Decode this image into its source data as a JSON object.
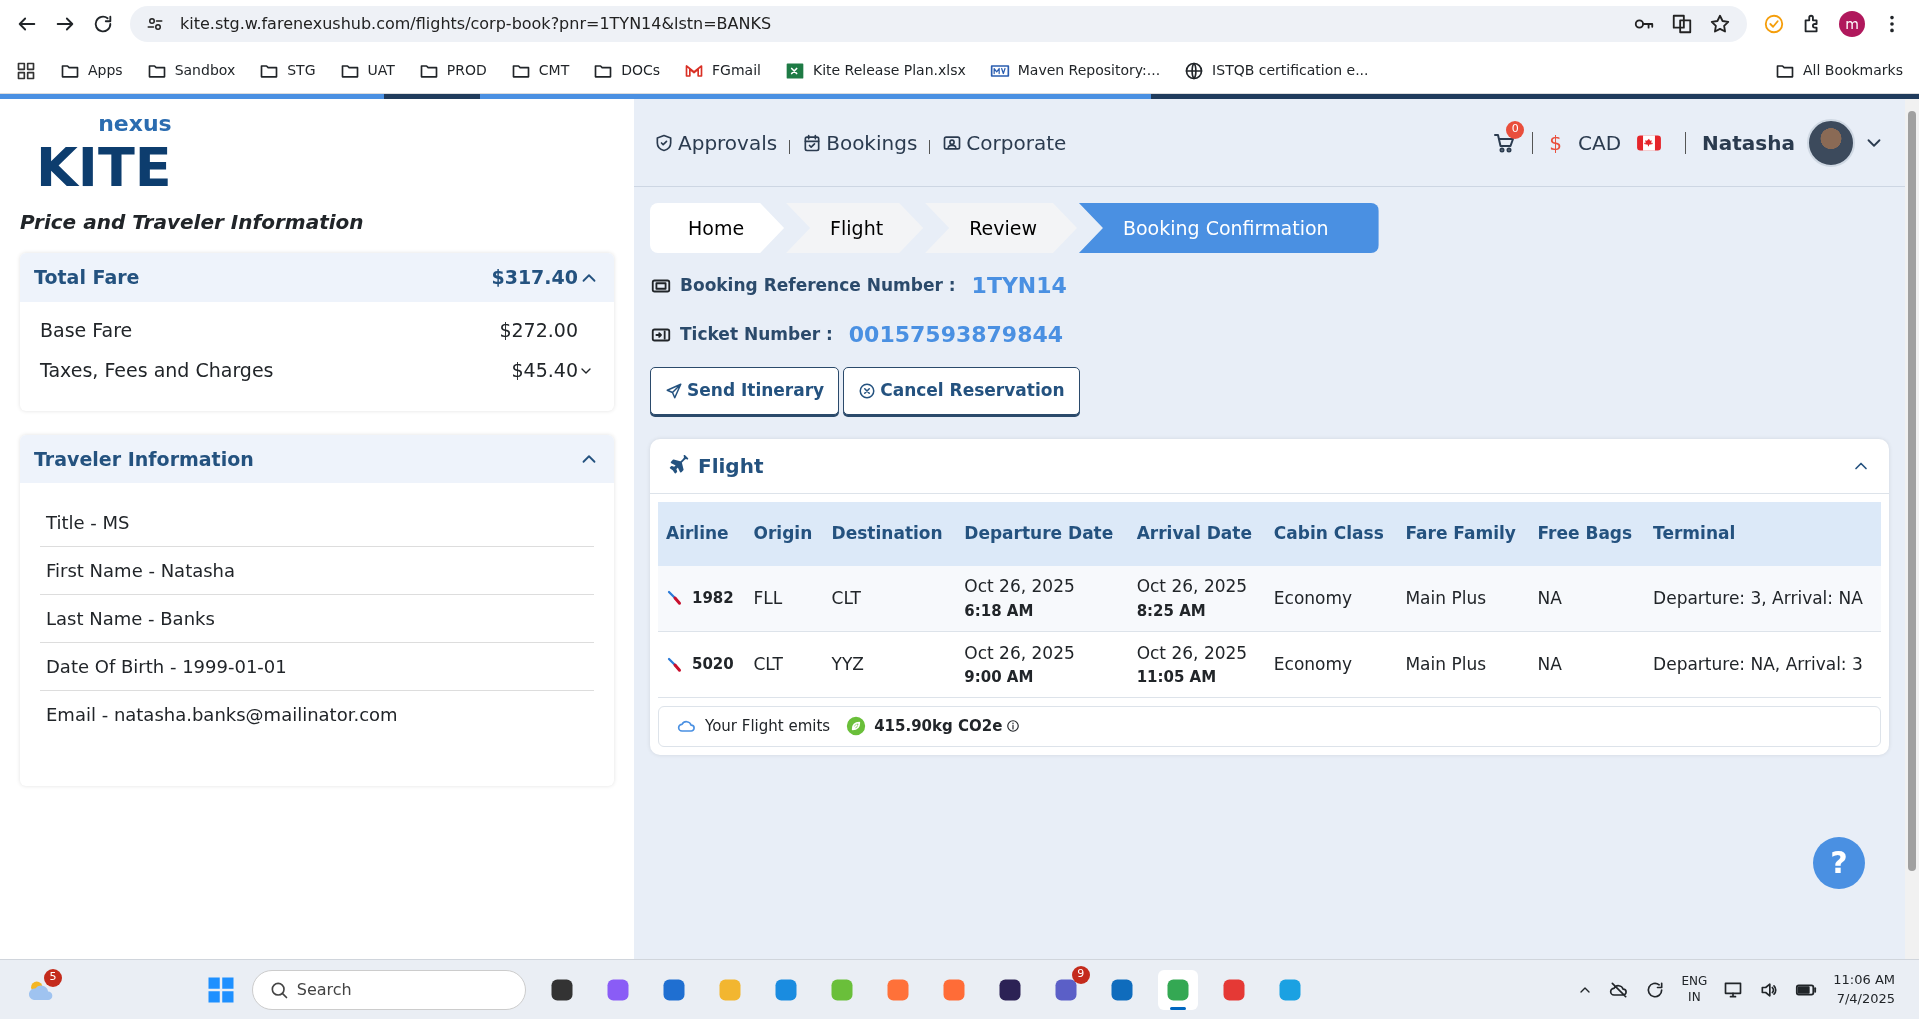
{
  "browser": {
    "url": "kite.stg.w.farenexushub.com/flights/corp-book?pnr=1TYN14&lstn=BANKS",
    "avatar_letter": "m",
    "bookmarks": [
      {
        "label": "Apps",
        "kind": "folder"
      },
      {
        "label": "Sandbox",
        "kind": "folder"
      },
      {
        "label": "STG",
        "kind": "folder"
      },
      {
        "label": "UAT",
        "kind": "folder"
      },
      {
        "label": "PROD",
        "kind": "folder"
      },
      {
        "label": "CMT",
        "kind": "folder"
      },
      {
        "label": "DOCs",
        "kind": "folder"
      },
      {
        "label": "FGmail",
        "kind": "mail"
      },
      {
        "label": "Kite Release Plan.xlsx",
        "kind": "sheet"
      },
      {
        "label": "Maven Repository:...",
        "kind": "maven"
      },
      {
        "label": "ISTQB certification e...",
        "kind": "globe"
      }
    ],
    "all_bookmarks": "All Bookmarks"
  },
  "logo": {
    "small": "nexus",
    "big": "KITE"
  },
  "left": {
    "heading": "Price and Traveler Information",
    "fare": {
      "title": "Total Fare",
      "total": "$317.40",
      "expanded": true,
      "lines": [
        {
          "label": "Base Fare",
          "amount": "$272.00",
          "expandable": false
        },
        {
          "label": "Taxes, Fees and Charges",
          "amount": "$45.40",
          "expandable": true
        }
      ]
    },
    "traveler": {
      "title": "Traveler Information",
      "expanded": true,
      "fields": [
        "Title - MS",
        "First Name - Natasha",
        "Last Name - Banks",
        "Date Of Birth - 1999-01-01",
        "Email - natasha.banks@mailinator.com"
      ]
    }
  },
  "nav": {
    "links": [
      {
        "label": "Approvals",
        "kind": "shield"
      },
      {
        "label": "Bookings",
        "kind": "calendar"
      },
      {
        "label": "Corporate",
        "kind": "id"
      }
    ],
    "cart_count": "0",
    "currency_symbol": "$",
    "currency": "CAD",
    "user": "Natasha"
  },
  "breadcrumb": [
    {
      "label": "Home",
      "selected": false
    },
    {
      "label": "Flight",
      "selected": false
    },
    {
      "label": "Review",
      "selected": false
    },
    {
      "label": "Booking Confirmation",
      "selected": true
    }
  ],
  "booking": {
    "reference_label": "Booking Reference Number :",
    "reference": "1TYN14",
    "ticket_label": "Ticket Number :",
    "ticket": "00157593879844"
  },
  "actions": [
    {
      "label": "Send Itinerary",
      "kind": "send"
    },
    {
      "label": "Cancel Reservation",
      "kind": "cancel"
    }
  ],
  "flight": {
    "title": "Flight",
    "expanded": true,
    "columns": [
      "Airline",
      "Origin",
      "Destination",
      "Departure Date",
      "Arrival Date",
      "Cabin Class",
      "Fare Family",
      "Free Bags",
      "Terminal"
    ],
    "rows": [
      {
        "flight": "1982",
        "origin": "FLL",
        "destination": "CLT",
        "dep_date": "Oct 26, 2025",
        "dep_time": "6:18 AM",
        "arr_date": "Oct 26, 2025",
        "arr_time": "8:25 AM",
        "cabin": "Economy",
        "fare_family": "Main Plus",
        "bags": "NA",
        "terminal": "Departure: 3, Arrival: NA"
      },
      {
        "flight": "5020",
        "origin": "CLT",
        "destination": "YYZ",
        "dep_date": "Oct 26, 2025",
        "dep_time": "9:00 AM",
        "arr_date": "Oct 26, 2025",
        "arr_time": "11:05 AM",
        "cabin": "Economy",
        "fare_family": "Main Plus",
        "bags": "NA",
        "terminal": "Departure: NA, Arrival: 3"
      }
    ],
    "emits_label": "Your Flight emits",
    "emission": "415.90kg CO2e"
  },
  "help": "?",
  "taskbar": {
    "weather_badge": "5",
    "search_placeholder": "Search",
    "apps": [
      {
        "kind": "taskview",
        "selected": false
      },
      {
        "kind": "copilot",
        "selected": false
      },
      {
        "kind": "store",
        "selected": false
      },
      {
        "kind": "files",
        "selected": false
      },
      {
        "kind": "code",
        "selected": false
      },
      {
        "kind": "paint",
        "selected": false
      },
      {
        "kind": "firefox",
        "selected": false
      },
      {
        "kind": "postman",
        "selected": false
      },
      {
        "kind": "eclipse",
        "selected": false
      },
      {
        "kind": "teams",
        "selected": false,
        "badge": "9"
      },
      {
        "kind": "outlook",
        "selected": false
      },
      {
        "kind": "chrome",
        "selected": true
      },
      {
        "kind": "wps",
        "selected": false
      },
      {
        "kind": "edge",
        "selected": false
      }
    ],
    "lang": "ENG",
    "region": "IN",
    "time": "11:06 AM",
    "date": "7/4/2025"
  }
}
